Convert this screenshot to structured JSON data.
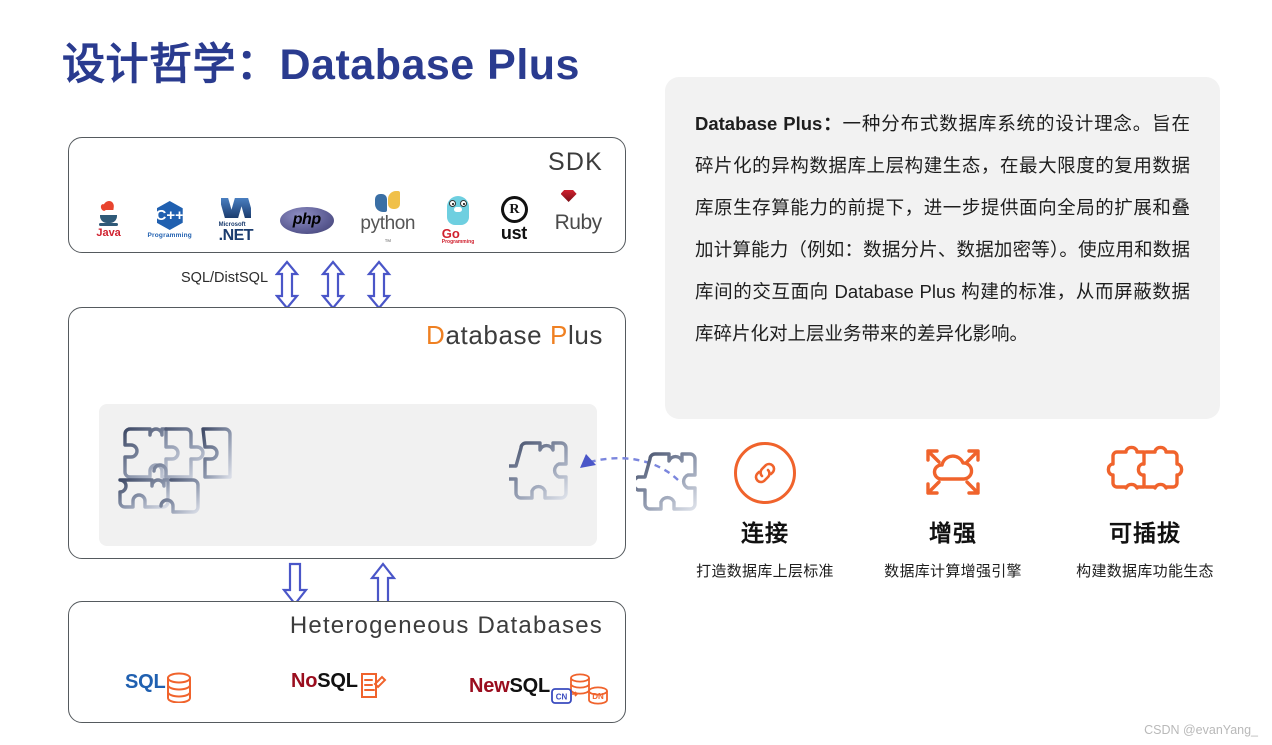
{
  "title": "设计哲学：Database Plus",
  "sdk_panel": {
    "label": "SDK",
    "logos": [
      {
        "name": "java-logo",
        "text": "Java"
      },
      {
        "name": "cpp-logo",
        "symbol": "C++",
        "text": "Programming"
      },
      {
        "name": "dotnet-logo",
        "microsoft": "Microsoft",
        "text": ".NET"
      },
      {
        "name": "php-logo",
        "text": "php"
      },
      {
        "name": "python-logo",
        "text": "python",
        "tm": "™"
      },
      {
        "name": "go-logo",
        "text": "Go",
        "sub": "Programming"
      },
      {
        "name": "rust-logo",
        "letter": "R",
        "text": "ust"
      },
      {
        "name": "ruby-logo",
        "text": "Ruby"
      }
    ]
  },
  "sql_connector": {
    "label": "SQL/DistSQL",
    "arrow_count": 3,
    "arrow_color": "#4a56c8"
  },
  "dbplus_panel": {
    "label_first": "D",
    "label_rest": "atabase ",
    "label_p": "P",
    "label_tail": "lus"
  },
  "hetero_panel": {
    "label": "Heterogeneous Databases",
    "databases": [
      {
        "name": "sql-db",
        "prefix": "",
        "prefix_color": "",
        "word": "SQL",
        "word_color": "#2060b0"
      },
      {
        "name": "nosql-db",
        "prefix": "No",
        "prefix_color": "#9a0d1e",
        "word": "SQL",
        "word_color": "#111111"
      },
      {
        "name": "newsql-db",
        "prefix": "New",
        "prefix_color": "#9a0d1e",
        "word": "SQL",
        "word_color": "#111111",
        "badge_cn": "CN",
        "badge_dn": "DN"
      }
    ]
  },
  "description": {
    "bold_lead": "Database  Plus：",
    "body": "一种分布式数据库系统的设计理念。旨在碎片化的异构数据库上层构建生态，在最大限度的复用数据库原生存算能力的前提下，进一步提供面向全局的扩展和叠加计算能力（例如：数据分片、数据加密等）。使应用和数据库间的交互面向 Database Plus 构建的标准，从而屏蔽数据库碎片化对上层业务带来的差异化影响。"
  },
  "features": [
    {
      "name": "connect",
      "icon": "link-icon",
      "label": "连接",
      "caption": "打造数据库上层标准"
    },
    {
      "name": "enhance",
      "icon": "cloud-expand-icon",
      "label": "增强",
      "caption": "数据库计算增强引擎"
    },
    {
      "name": "pluggable",
      "icon": "puzzle-pair-icon",
      "label": "可插拔",
      "caption": "构建数据库功能生态"
    }
  ],
  "colors": {
    "title": "#2a3b8f",
    "orange": "#f0632c",
    "arrow_blue": "#4a56c8",
    "panel_border": "#555a5e",
    "card_bg": "#f2f2f2"
  },
  "watermark": "CSDN @evanYang_"
}
